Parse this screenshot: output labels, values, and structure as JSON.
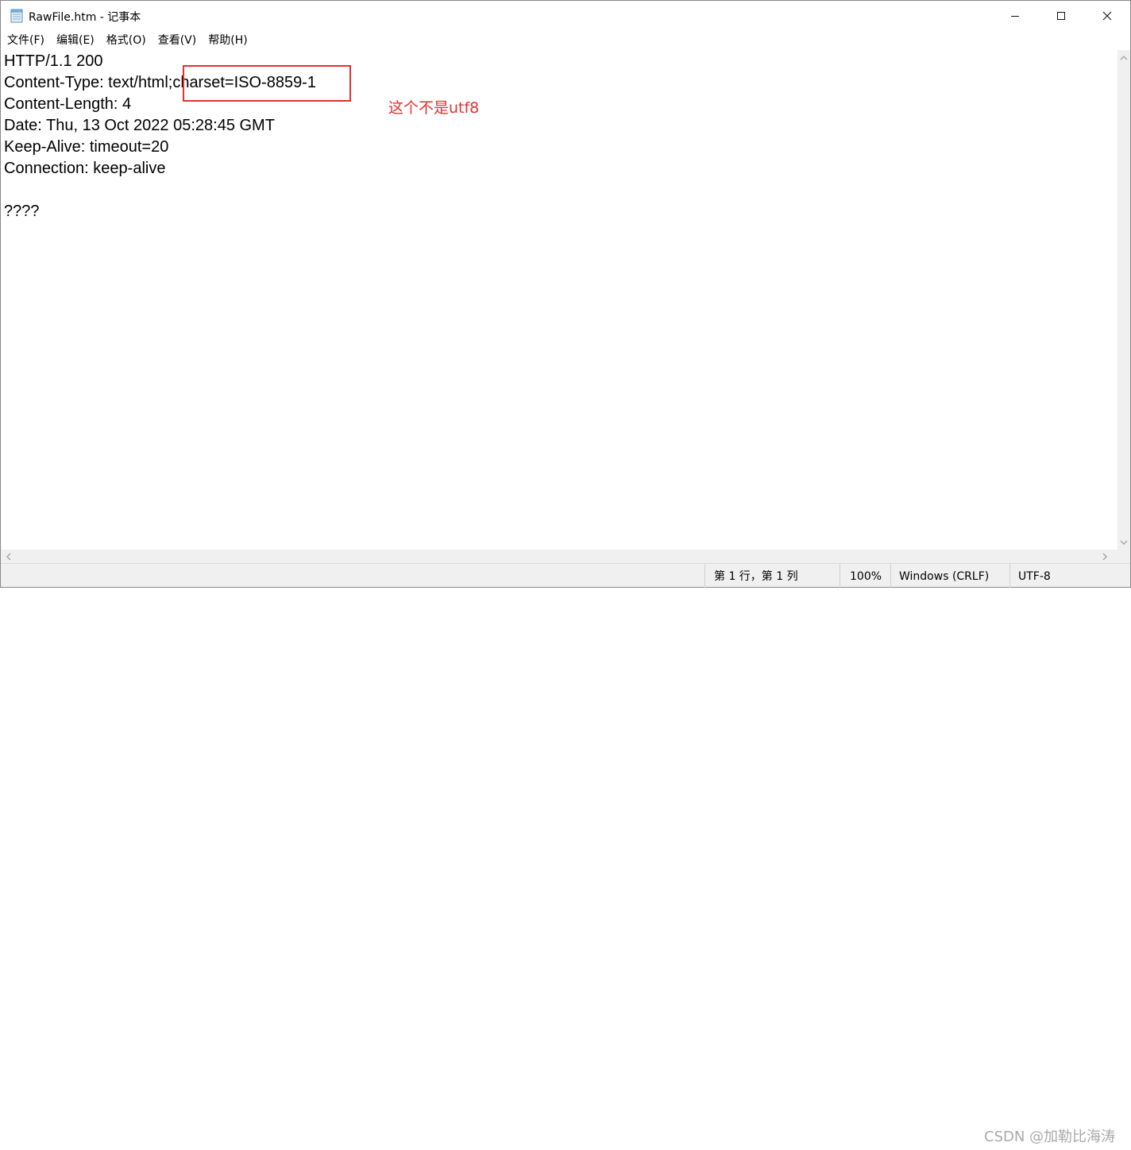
{
  "window": {
    "title": "RawFile.htm - 记事本"
  },
  "menu": [
    "文件(F)",
    "编辑(E)",
    "格式(O)",
    "查看(V)",
    "帮助(H)"
  ],
  "editor": {
    "content": "HTTP/1.1 200\nContent-Type: text/html;charset=ISO-8859-1\nContent-Length: 4\nDate: Thu, 13 Oct 2022 05:28:45 GMT\nKeep-Alive: timeout=20\nConnection: keep-alive\n\n????"
  },
  "annotation": {
    "text": "这个不是utf8",
    "color": "#e0322e"
  },
  "status": {
    "position": "第 1 行，第 1 列",
    "zoom": "100%",
    "line_ending": "Windows (CRLF)",
    "encoding": "UTF-8"
  },
  "watermark": "CSDN @加勒比海涛",
  "icons": {
    "app": "notepad-icon",
    "minimize": "minimize-icon",
    "maximize": "maximize-icon",
    "close": "close-icon"
  }
}
